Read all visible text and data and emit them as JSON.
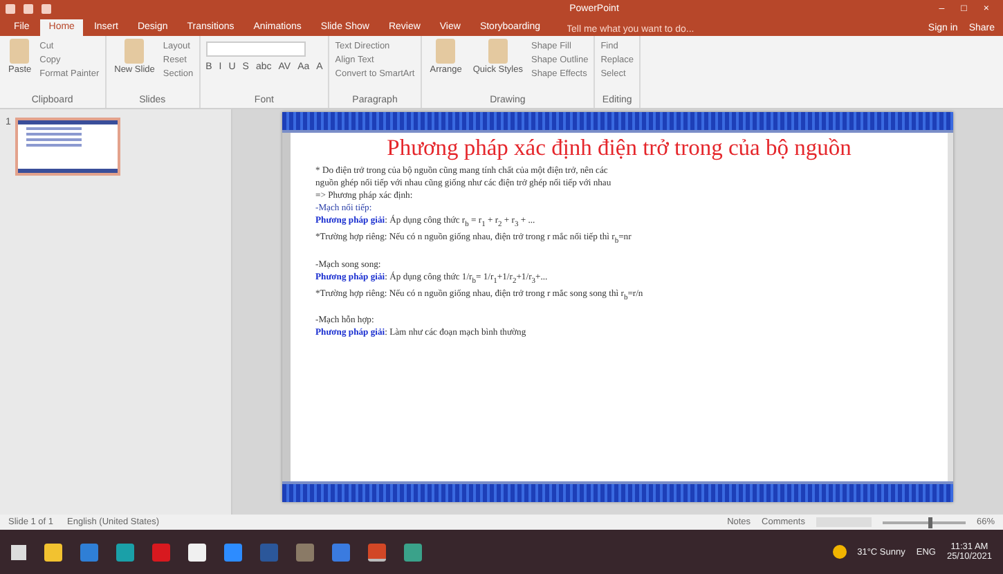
{
  "window": {
    "title": "PowerPoint",
    "controls": [
      "–",
      "□",
      "×"
    ]
  },
  "tabs": [
    {
      "label": "File",
      "selected": false
    },
    {
      "label": "Home",
      "selected": true
    },
    {
      "label": "Insert",
      "selected": false
    },
    {
      "label": "Design",
      "selected": false
    },
    {
      "label": "Transitions",
      "selected": false
    },
    {
      "label": "Animations",
      "selected": false
    },
    {
      "label": "Slide Show",
      "selected": false
    },
    {
      "label": "Review",
      "selected": false
    },
    {
      "label": "View",
      "selected": false
    },
    {
      "label": "Storyboarding",
      "selected": false
    }
  ],
  "tell_me": {
    "placeholder": "Tell me what you want to do..."
  },
  "account": [
    "Sign in",
    "Share"
  ],
  "ribbon": [
    {
      "label": "Clipboard",
      "large": [
        "Paste"
      ],
      "small": [
        "Cut",
        "Copy",
        "Format Painter"
      ]
    },
    {
      "label": "Slides",
      "large": [
        "New Slide"
      ],
      "small": [
        "Layout",
        "Reset",
        "Section"
      ]
    },
    {
      "label": "Font",
      "tools": [
        "B",
        "I",
        "U",
        "S",
        "abc",
        "AV",
        "Aa",
        "A"
      ]
    },
    {
      "label": "Paragraph",
      "small": [
        "Text Direction",
        "Align Text",
        "Convert to SmartArt"
      ]
    },
    {
      "label": "Drawing",
      "large": [
        "Arrange",
        "Quick Styles"
      ],
      "small": [
        "Shape Fill",
        "Shape Outline",
        "Shape Effects"
      ]
    },
    {
      "label": "Editing",
      "small": [
        "Find",
        "Replace",
        "Select"
      ]
    }
  ],
  "thumbnails": [
    {
      "number": "1",
      "selected": true
    }
  ],
  "slide": {
    "title": "Phương pháp xác định điện trở trong của bộ nguồn",
    "lines": [
      {
        "kind": "text",
        "text": "* Do điện trở trong của bộ nguồn cũng mang tính chất của một điện trở, nên các"
      },
      {
        "kind": "text",
        "text": "nguồn ghép nối tiếp với nhau cũng giống như các điện trở ghép nối tiếp với nhau"
      },
      {
        "kind": "text",
        "text": "=> Phương pháp xác định:"
      },
      {
        "kind": "heading",
        "text": "-Mạch nối tiếp:"
      },
      {
        "kind": "text",
        "text": "**Phương pháp giải**: Áp dụng công thức r$_{b}$ = r$_{1}$ + r$_{2}$ + r$_{3}$ + ..."
      },
      {
        "kind": "text",
        "text": "*Trường hợp riêng: Nếu có n nguồn giống nhau, điện trở trong r mắc nối tiếp thì r$_{b}$=nr"
      },
      {
        "kind": "gap"
      },
      {
        "kind": "text",
        "text": "-Mạch song song:"
      },
      {
        "kind": "text",
        "text": "**Phương pháp giải**: Áp dụng công thức 1/r$_{b}$= 1/r$_{1}$+1/r$_{2}$+1/r$_{3}$+..."
      },
      {
        "kind": "text",
        "text": "*Trường hợp riêng: Nếu có n nguồn giống nhau, điện trở trong r mắc song song thì r$_{b}$=r/n"
      },
      {
        "kind": "gap"
      },
      {
        "kind": "text",
        "text": "-Mạch hỗn hợp:"
      },
      {
        "kind": "text",
        "text": "**Phương pháp giải**: Làm như các đoạn mạch bình thường"
      }
    ]
  },
  "status_bar": {
    "left": [
      "Slide 1 of 1",
      "English (United States)"
    ],
    "right": [
      "Notes",
      "Comments"
    ],
    "zoom": {
      "level": 0.55,
      "reading": "66%"
    }
  },
  "taskbar": {
    "apps": [
      {
        "kind": "files",
        "active": false
      },
      {
        "kind": "mail",
        "active": false
      },
      {
        "kind": "edge",
        "active": false
      },
      {
        "kind": "opera",
        "active": false
      },
      {
        "kind": "doc",
        "active": false
      },
      {
        "kind": "zoom",
        "active": false
      },
      {
        "kind": "word",
        "active": false
      },
      {
        "kind": "photo",
        "active": false
      },
      {
        "kind": "chat",
        "active": false
      },
      {
        "kind": "powerpoint",
        "active": true
      },
      {
        "kind": "app",
        "active": false
      }
    ],
    "weather": "31°C Sunny",
    "language": "ENG",
    "time": "11:31 AM",
    "date": "25/10/2021"
  }
}
